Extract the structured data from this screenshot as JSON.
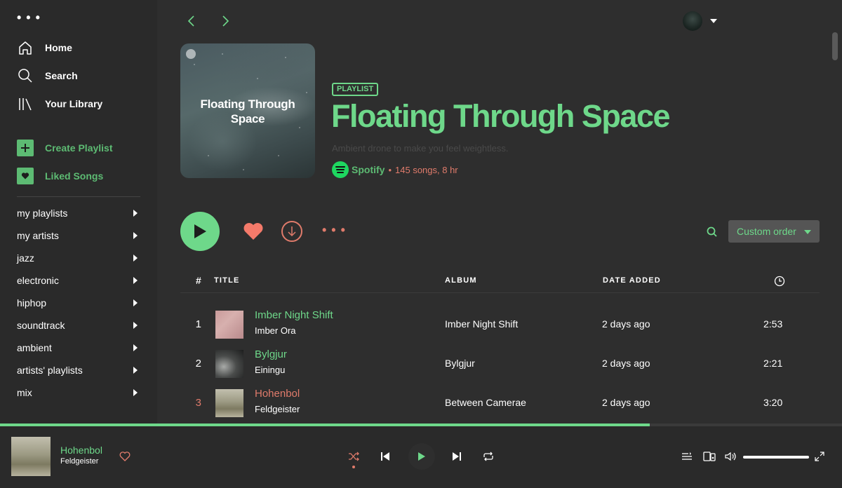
{
  "sidebar": {
    "nav": [
      {
        "label": "Home",
        "icon": "home-icon"
      },
      {
        "label": "Search",
        "icon": "search-icon"
      },
      {
        "label": "Your Library",
        "icon": "library-icon"
      }
    ],
    "create_playlist": "Create Playlist",
    "liked_songs": "Liked Songs",
    "folders": [
      "my playlists",
      "my artists",
      "jazz",
      "electronic",
      "hiphop",
      "soundtrack",
      "ambient",
      "artists' playlists",
      "mix"
    ]
  },
  "header": {
    "badge": "PLAYLIST",
    "title": "Floating Through Space",
    "cover_text": "Floating Through Space",
    "description": "Ambient drone to make you feel weightless.",
    "owner": "Spotify",
    "separator": "•",
    "meta": "145 songs, 8 hr"
  },
  "actions": {
    "sort_label": "Custom order"
  },
  "table": {
    "headers": {
      "num": "#",
      "title": "TITLE",
      "album": "ALBUM",
      "date": "DATE ADDED"
    },
    "rows": [
      {
        "num": "1",
        "title": "Imber Night Shift",
        "artist": "Imber Ora",
        "album": "Imber Night Shift",
        "date_added": "2 days ago",
        "duration": "2:53",
        "playing": false
      },
      {
        "num": "2",
        "title": "Bylgjur",
        "artist": "Einingu",
        "album": "Bylgjur",
        "date_added": "2 days ago",
        "duration": "2:21",
        "playing": false
      },
      {
        "num": "3",
        "title": "Hohenbol",
        "artist": "Feldgeister",
        "album": "Between Camerae",
        "date_added": "2 days ago",
        "duration": "3:20",
        "playing": true
      }
    ]
  },
  "now_playing": {
    "title": "Hohenbol",
    "artist": "Feldgeister",
    "progress": 0.772,
    "volume": 1.0
  },
  "colors": {
    "accent_green": "#6ed88a",
    "accent_salmon": "#e07b6b",
    "background": "#2e2e2e"
  }
}
